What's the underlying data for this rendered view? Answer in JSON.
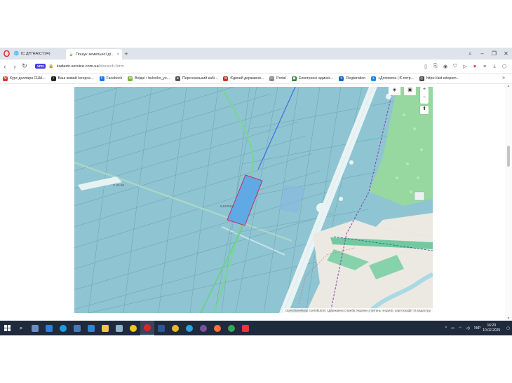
{
  "browser": {
    "tabs": [
      {
        "label": "ІС ДП\"НАІС\"(04)",
        "active": false
      },
      {
        "label": "Пошук земельної ділян",
        "active": true
      }
    ],
    "url_host": "kadastr-service.com.ua",
    "url_path": "/#search-form",
    "vpn_label": "VPN"
  },
  "bookmarks": [
    {
      "label": "Курс доллара США...",
      "color": "#d9342b",
      "icon": "M"
    },
    {
      "label": "Ваш живий Інтерне...",
      "color": "#222222",
      "icon": "•"
    },
    {
      "label": "Facebook",
      "color": "#1877f2",
      "icon": "f"
    },
    {
      "label": "Вхідні • bulenko_ye...",
      "color": "#7fb33a",
      "icon": "✉"
    },
    {
      "label": "Персональний кабі...",
      "color": "#555555",
      "icon": "●"
    },
    {
      "label": "Єдиний державни...",
      "color": "#c0392b",
      "icon": "⚖"
    },
    {
      "label": "Portal",
      "color": "#888888",
      "icon": "▭"
    },
    {
      "label": "Електронні адмініс...",
      "color": "#2e7d32",
      "icon": "▣"
    },
    {
      "label": "Registration",
      "color": "#1565c0",
      "icon": "≡"
    },
    {
      "label": "«Допомога | Є потр...",
      "color": "#1e88e5",
      "icon": "◐"
    },
    {
      "label": "https://aid.edopom...",
      "color": "#444444",
      "icon": "◎"
    }
  ],
  "map": {
    "labels": [
      {
        "text": "С 25-50"
      },
      {
        "text": "8,6225ha"
      }
    ],
    "attribution": "OpenStreetMap contributors | Державна служба України з питань геодезії, картографії та кадастру",
    "zoom_in": "+",
    "zoom_out": "−",
    "compass": "⬆"
  },
  "taskbar": {
    "language": "УКР",
    "time": "16:20",
    "date": "10.02.2025"
  }
}
